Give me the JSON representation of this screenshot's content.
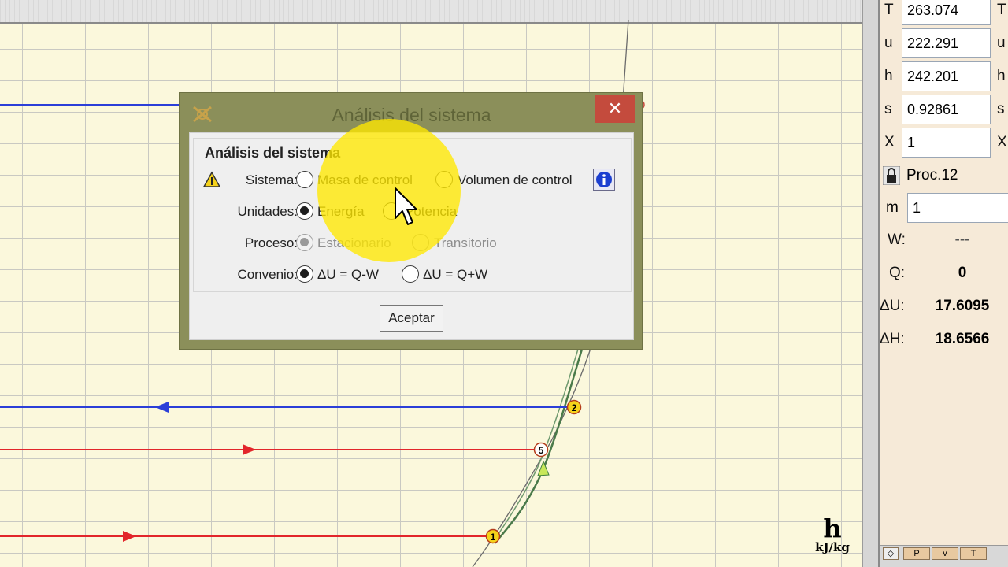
{
  "dialog": {
    "title": "Análisis del sistema",
    "close_label": "✕",
    "group_title": "Análisis del sistema",
    "rows": {
      "sistema": {
        "label": "Sistema:",
        "opt1": "Masa de control",
        "opt2": "Volumen de control",
        "selected": "none"
      },
      "unidades": {
        "label": "Unidades:",
        "opt1": "Energía",
        "opt2": "Potencia",
        "selected": "Energía"
      },
      "proceso": {
        "label": "Proceso:",
        "opt1": "Estacionario",
        "opt2": "Transitorio",
        "selected": "Estacionario",
        "disabled": true
      },
      "convenio": {
        "label": "Convenio:",
        "opt1": "ΔU = Q-W",
        "opt2": "ΔU = Q+W",
        "selected": "ΔU = Q-W"
      }
    },
    "accept_label": "Aceptar",
    "icons": {
      "app": "app-logo-icon",
      "warning": "warning-icon",
      "info": "info-icon"
    }
  },
  "panel": {
    "properties": [
      {
        "name": "T",
        "value": "263.074",
        "unit": "T"
      },
      {
        "name": "u",
        "value": "222.291",
        "unit": "u"
      },
      {
        "name": "h",
        "value": "242.201",
        "unit": "h"
      },
      {
        "name": "s",
        "value": "0.92861",
        "unit": "s"
      },
      {
        "name": "X",
        "value": "1",
        "unit": "X"
      }
    ],
    "process": "Proc.12",
    "mass_label": "m",
    "mass_value": "1",
    "results": [
      {
        "label": "W:",
        "value": "---"
      },
      {
        "label": "Q:",
        "value": "0"
      },
      {
        "label": "ΔU:",
        "value": "17.6095"
      },
      {
        "label": "ΔH:",
        "value": "18.6566"
      }
    ],
    "bottom_tabs": [
      "P",
      "v",
      "T"
    ]
  },
  "chart": {
    "unit_big": "h",
    "unit_small": "kJ/kg",
    "state_points": [
      "1",
      "2",
      "5"
    ],
    "colors": {
      "blue": "#2b3fd8",
      "red": "#e2262b",
      "green": "#3f7f3f",
      "accent": "#c44b3d"
    }
  }
}
